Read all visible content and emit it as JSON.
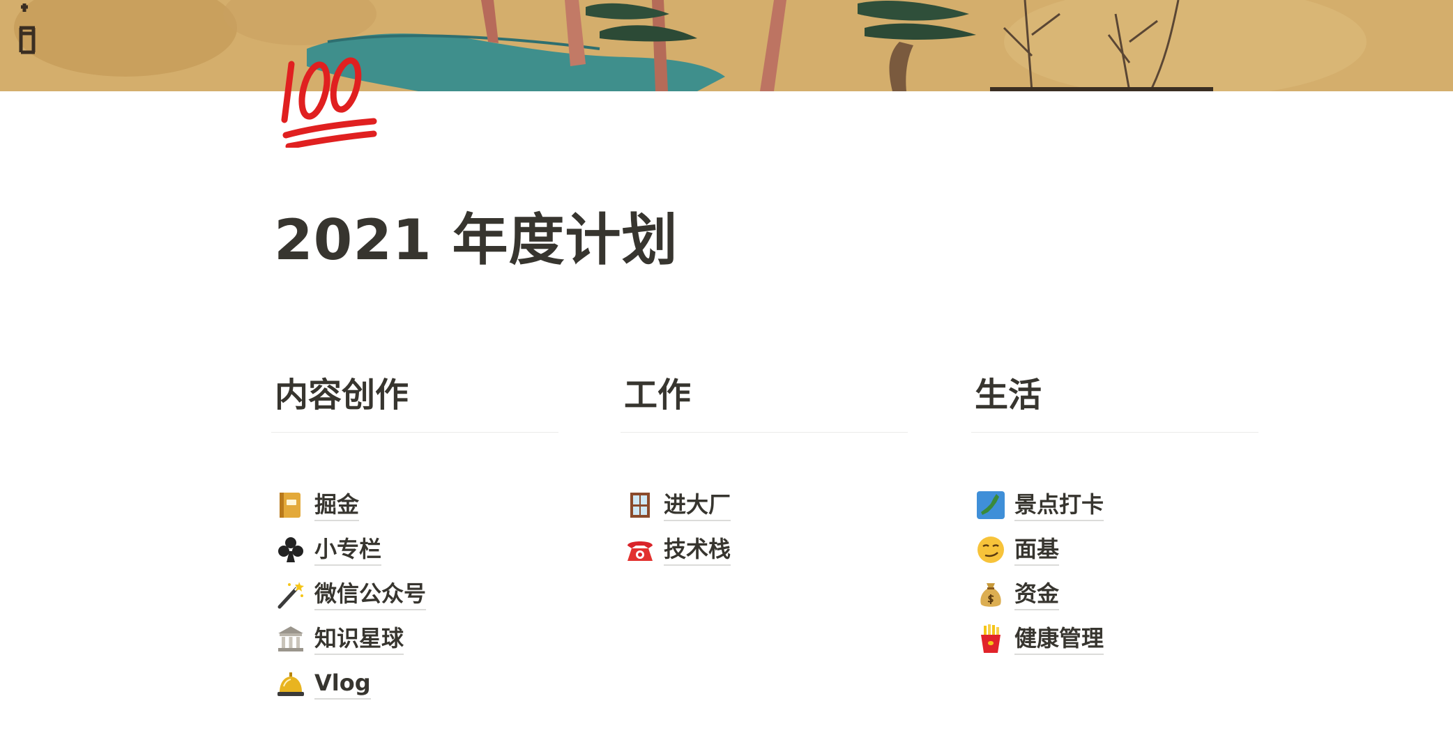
{
  "page": {
    "title": "2021 年度计划",
    "icon": "hundred-points-emoji"
  },
  "cover": {
    "description_icon": "ukiyo-e-landscape-cover"
  },
  "columns": [
    {
      "heading": "内容创作",
      "items": [
        {
          "label": "掘金",
          "icon": "ledger-icon"
        },
        {
          "label": "小专栏",
          "icon": "club-suit-icon"
        },
        {
          "label": "微信公众号",
          "icon": "magic-wand-icon"
        },
        {
          "label": "知识星球",
          "icon": "classical-building-icon"
        },
        {
          "label": "Vlog",
          "icon": "bellhop-bell-icon"
        }
      ]
    },
    {
      "heading": "工作",
      "items": [
        {
          "label": "进大厂",
          "icon": "window-icon"
        },
        {
          "label": "技术栈",
          "icon": "telephone-icon"
        }
      ]
    },
    {
      "heading": "生活",
      "items": [
        {
          "label": "景点打卡",
          "icon": "map-of-japan-icon"
        },
        {
          "label": "面基",
          "icon": "smirking-face-icon"
        },
        {
          "label": "资金",
          "icon": "money-bag-icon"
        },
        {
          "label": "健康管理",
          "icon": "french-fries-icon"
        }
      ]
    }
  ],
  "colors": {
    "text": "#37352f",
    "divider": "#ebebea",
    "accent_red": "#e02020",
    "cover_base": "#d8b474"
  }
}
